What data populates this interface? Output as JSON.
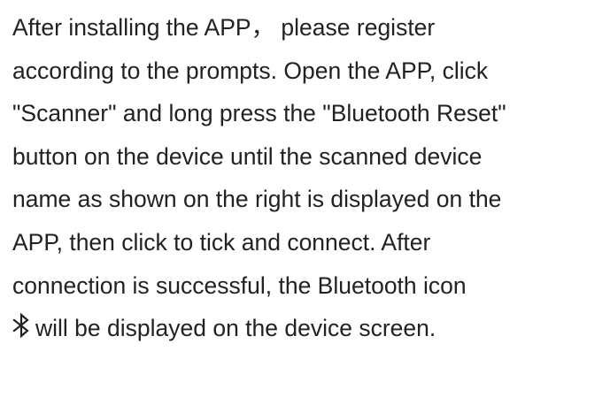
{
  "document": {
    "lines": [
      "After installing the APP， please register",
      "according to the prompts. Open the APP, click",
      "\"Scanner\" and long press the \"Bluetooth Reset\"",
      "button on the device until the scanned device",
      "name as shown on the right is displayed on the",
      "APP, then click to tick and connect. After",
      "connection is successful, the Bluetooth icon",
      ""
    ],
    "last_line": "will be displayed on the device screen.",
    "icon": "bluetooth-icon"
  }
}
